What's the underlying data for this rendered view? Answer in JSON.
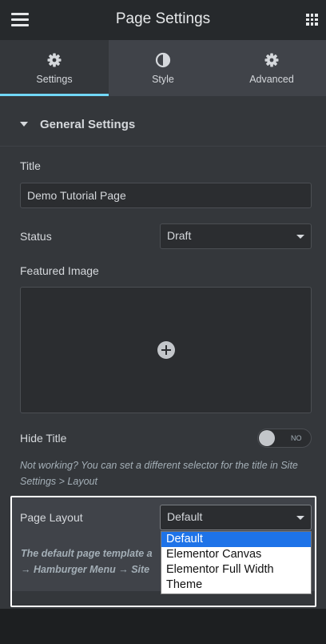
{
  "header": {
    "title": "Page Settings",
    "menu_icon": "hamburger-menu-icon",
    "apps_icon": "grid-apps-icon"
  },
  "tabs": [
    {
      "label": "Settings",
      "icon": "gear-icon",
      "active": true
    },
    {
      "label": "Style",
      "icon": "half-circle-icon",
      "active": false
    },
    {
      "label": "Advanced",
      "icon": "gear-icon",
      "active": false
    }
  ],
  "section": {
    "title": "General Settings"
  },
  "fields": {
    "title_label": "Title",
    "title_value": "Demo Tutorial Page",
    "status_label": "Status",
    "status_value": "Draft",
    "featured_image_label": "Featured Image",
    "hide_title_label": "Hide Title",
    "hide_title_toggle": "NO",
    "hide_title_help": "Not working? You can set a different selector for the title in Site Settings > Layout",
    "page_layout_label": "Page Layout",
    "page_layout_value": "Default",
    "page_layout_help_1": "The default page template a",
    "page_layout_help_2": "→ Hamburger Menu → Site"
  },
  "layout_dropdown": {
    "options": [
      "Default",
      "Elementor Canvas",
      "Elementor Full Width",
      "Theme"
    ],
    "selected": "Default"
  },
  "colors": {
    "accent": "#71d7f7",
    "panel_bg": "#34373b",
    "header_bg": "#26292c",
    "option_selected": "#1e73e8"
  }
}
